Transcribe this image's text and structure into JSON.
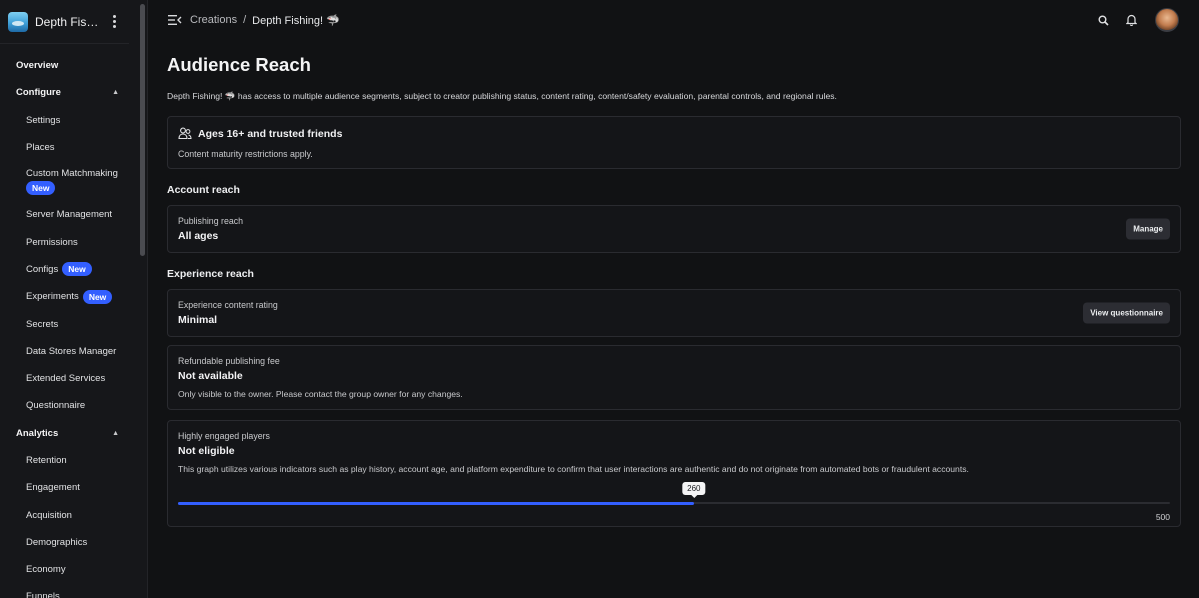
{
  "sidebar": {
    "game_name": "Depth Fishing!",
    "items": [
      {
        "label": "Overview",
        "kind": "top"
      },
      {
        "label": "Configure",
        "kind": "section"
      },
      {
        "label": "Settings",
        "kind": "item"
      },
      {
        "label": "Places",
        "kind": "item"
      },
      {
        "label": "Custom Matchmaking",
        "kind": "tall",
        "badge": "New"
      },
      {
        "label": "Server Management",
        "kind": "item"
      },
      {
        "label": "Permissions",
        "kind": "item"
      },
      {
        "label": "Configs",
        "kind": "item",
        "badge": "New"
      },
      {
        "label": "Experiments",
        "kind": "item",
        "badge": "New"
      },
      {
        "label": "Secrets",
        "kind": "item"
      },
      {
        "label": "Data Stores Manager",
        "kind": "item"
      },
      {
        "label": "Extended Services",
        "kind": "item"
      },
      {
        "label": "Questionnaire",
        "kind": "item"
      },
      {
        "label": "Analytics",
        "kind": "section"
      },
      {
        "label": "Retention",
        "kind": "item"
      },
      {
        "label": "Engagement",
        "kind": "item"
      },
      {
        "label": "Acquisition",
        "kind": "item"
      },
      {
        "label": "Demographics",
        "kind": "item"
      },
      {
        "label": "Economy",
        "kind": "item"
      },
      {
        "label": "Funnels",
        "kind": "item"
      }
    ]
  },
  "topbar": {
    "crumb_link": "Creations",
    "crumb_sep": "/",
    "crumb_current": "Depth Fishing! 🦈"
  },
  "page": {
    "title": "Audience Reach",
    "intro": "Depth Fishing! 🦈 has access to multiple audience segments, subject to creator publishing status, content rating, content/safety evaluation, parental controls, and regional rules.",
    "audience_card": {
      "title": "Ages 16+ and trusted friends",
      "desc": "Content maturity restrictions apply."
    },
    "account_reach_title": "Account reach",
    "publishing": {
      "label": "Publishing reach",
      "value": "All ages",
      "button": "Manage"
    },
    "experience_reach_title": "Experience reach",
    "content_rating": {
      "label": "Experience content rating",
      "value": "Minimal",
      "button": "View questionnaire"
    },
    "refundable": {
      "label": "Refundable publishing fee",
      "value": "Not available",
      "desc": "Only visible to the owner. Please contact the group owner for any changes."
    },
    "engaged": {
      "label": "Highly engaged players",
      "value": "Not eligible",
      "desc": "This graph utilizes various indicators such as play history, account age, and platform expenditure to confirm that user interactions are authentic and do not originate from automated bots or fraudulent accounts.",
      "current": 260,
      "current_label": "260",
      "max": 500,
      "max_label": "500"
    }
  },
  "colors": {
    "accent": "#335fff",
    "background": "#111214"
  }
}
